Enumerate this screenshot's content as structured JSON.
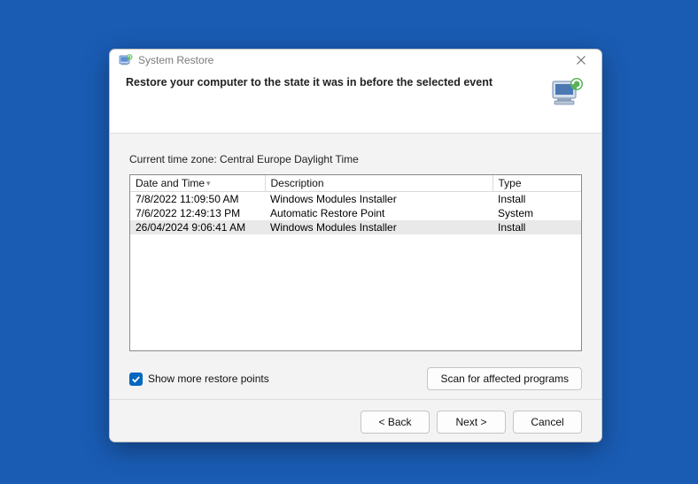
{
  "titlebar": {
    "title": "System Restore"
  },
  "header": {
    "heading": "Restore your computer to the state it was in before the selected event"
  },
  "content": {
    "timezone_label": "Current time zone: Central Europe Daylight Time",
    "columns": {
      "date": "Date and Time",
      "description": "Description",
      "type": "Type"
    },
    "rows": [
      {
        "date": "7/8/2022 11:09:50 AM",
        "description": "Windows Modules Installer",
        "type": "Install",
        "selected": false
      },
      {
        "date": "7/6/2022 12:49:13 PM",
        "description": "Automatic Restore Point",
        "type": "System",
        "selected": false
      },
      {
        "date": "26/04/2024 9:06:41 AM",
        "description": "Windows Modules Installer",
        "type": "Install",
        "selected": true
      }
    ],
    "show_more_label": "Show more restore points",
    "scan_label": "Scan for affected programs"
  },
  "footer": {
    "back": "< Back",
    "next": "Next >",
    "cancel": "Cancel"
  }
}
